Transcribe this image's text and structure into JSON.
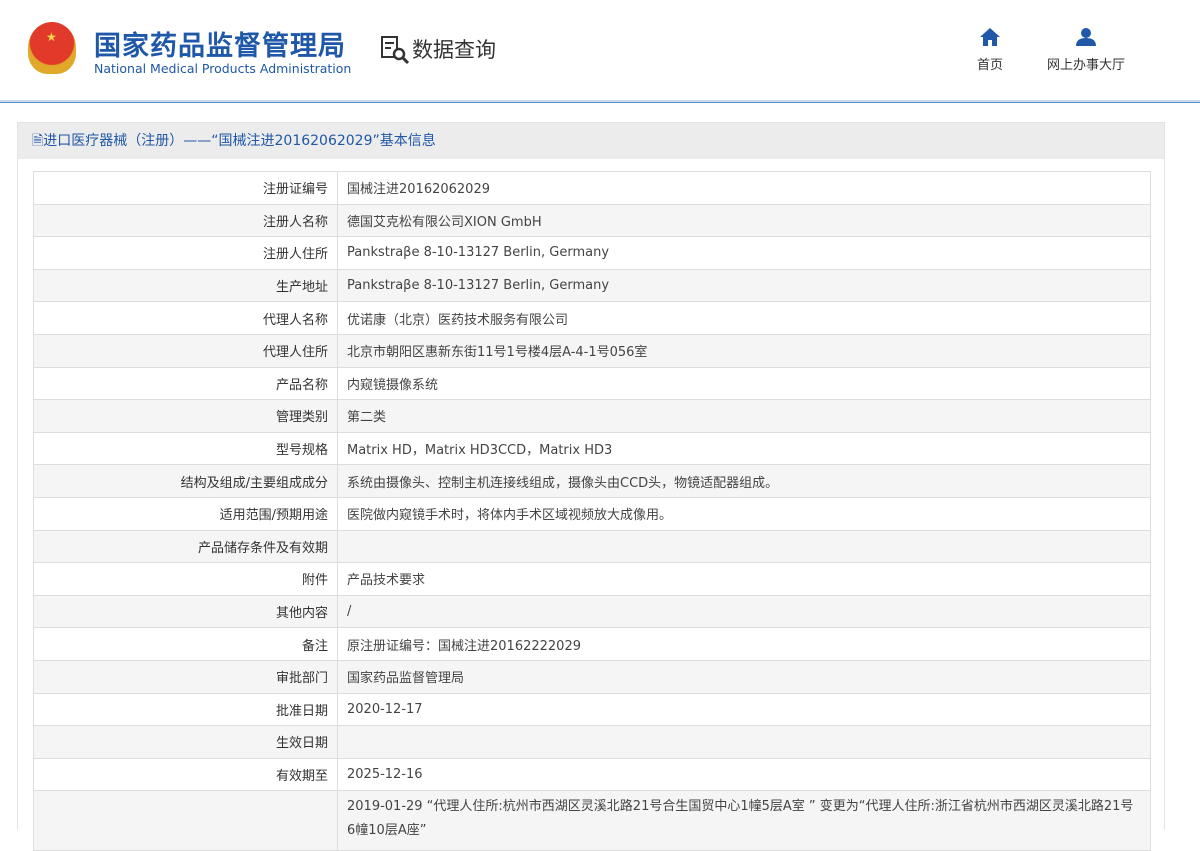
{
  "header": {
    "brand_cn": "国家药品监督管理局",
    "brand_en": "National Medical Products Administration",
    "section": "数据查询",
    "nav": [
      {
        "label": "首页",
        "icon": "home-icon"
      },
      {
        "label": "网上办事大厅",
        "icon": "user-icon"
      }
    ]
  },
  "panel": {
    "title": "进口医疗器械（注册）——“国械注进20162062029”基本信息"
  },
  "rows": [
    {
      "label": "注册证编号",
      "value": "国械注进20162062029"
    },
    {
      "label": "注册人名称",
      "value": "德国艾克松有限公司XION GmbH"
    },
    {
      "label": "注册人住所",
      "value": "Pankstraβe 8-10-13127 Berlin, Germany"
    },
    {
      "label": "生产地址",
      "value": "Pankstraβe 8-10-13127 Berlin, Germany"
    },
    {
      "label": "代理人名称",
      "value": "优诺康（北京）医药技术服务有限公司"
    },
    {
      "label": "代理人住所",
      "value": "北京市朝阳区惠新东街11号1号楼4层A-4-1号056室"
    },
    {
      "label": "产品名称",
      "value": "内窥镜摄像系统"
    },
    {
      "label": "管理类别",
      "value": "第二类"
    },
    {
      "label": "型号规格",
      "value": "Matrix HD，Matrix HD3CCD，Matrix HD3"
    },
    {
      "label": "结构及组成/主要组成成分",
      "value": "系统由摄像头、控制主机连接线组成，摄像头由CCD头，物镜适配器组成。"
    },
    {
      "label": "适用范围/预期用途",
      "value": "医院做内窥镜手术时，将体内手术区域视频放大成像用。"
    },
    {
      "label": "产品储存条件及有效期",
      "value": ""
    },
    {
      "label": "附件",
      "value": "产品技术要求"
    },
    {
      "label": "其他内容",
      "value": "/"
    },
    {
      "label": "备注",
      "value": "原注册证编号：国械注进20162222029"
    },
    {
      "label": "审批部门",
      "value": "国家药品监督管理局"
    },
    {
      "label": "批准日期",
      "value": "2020-12-17"
    },
    {
      "label": "生效日期",
      "value": ""
    },
    {
      "label": "有效期至",
      "value": "2025-12-16"
    },
    {
      "label": "",
      "value": "2019-01-29 “代理人住所:杭州市西湖区灵溪北路21号合生国贸中心1幢5层A室 ” 变更为“代理人住所:浙江省杭州市西湖区灵溪北路21号6幢10层A座”"
    }
  ]
}
